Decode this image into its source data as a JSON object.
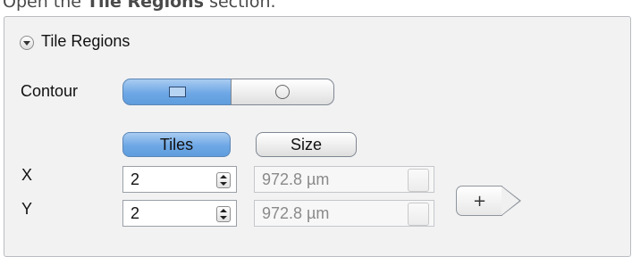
{
  "instruction": {
    "prefix": "Open the ",
    "bold": "Tile Regions",
    "suffix": " section."
  },
  "section": {
    "title": "Tile Regions"
  },
  "contour": {
    "label": "Contour",
    "options": [
      {
        "icon": "rectangle-icon",
        "selected": true
      },
      {
        "icon": "circle-icon",
        "selected": false
      }
    ]
  },
  "mode": {
    "tiles_label": "Tiles",
    "size_label": "Size",
    "selected": "Tiles"
  },
  "rows": [
    {
      "axis": "X",
      "tiles": "2",
      "size": "972.8 µm"
    },
    {
      "axis": "Y",
      "tiles": "2",
      "size": "972.8 µm"
    }
  ],
  "add_button": {
    "label": "+"
  },
  "colors": {
    "selected_blue": "#6ea7e5",
    "panel_bg": "#f2f2f3"
  }
}
